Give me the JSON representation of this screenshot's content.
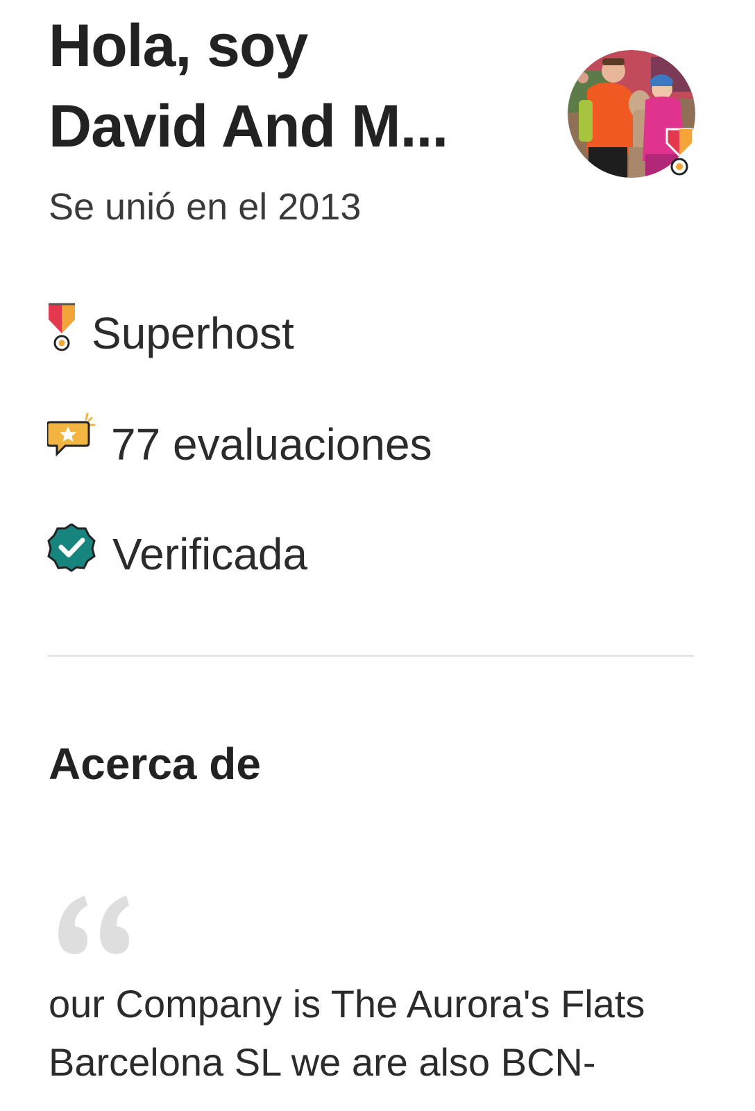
{
  "profile": {
    "greeting_line1": "Hola, soy",
    "greeting_line2": "David And M...",
    "joined": "Se unió en el 2013",
    "avatar_icon": "profile-photo-avatar",
    "badge_icon": "superhost-medal-icon"
  },
  "stats": {
    "superhost": {
      "label": "Superhost",
      "icon": "superhost-medal-icon"
    },
    "reviews": {
      "label": "77 evaluaciones",
      "icon": "review-speech-bubble-star-icon"
    },
    "verified": {
      "label": "Verificada",
      "icon": "verified-check-badge-icon"
    }
  },
  "about": {
    "title": "Acerca de",
    "quote_icon": "quote-mark-icon",
    "text": "our Company is The Aurora's Flats\nBarcelona SL we are also  BCN-"
  },
  "colors": {
    "text": "#222222",
    "superhost_red": "#e2394f",
    "superhost_orange": "#f3a53a",
    "review_gold": "#f2b542",
    "verified_teal": "#17857e",
    "divider": "#e6e6e6",
    "quote_gray": "#dedede"
  }
}
